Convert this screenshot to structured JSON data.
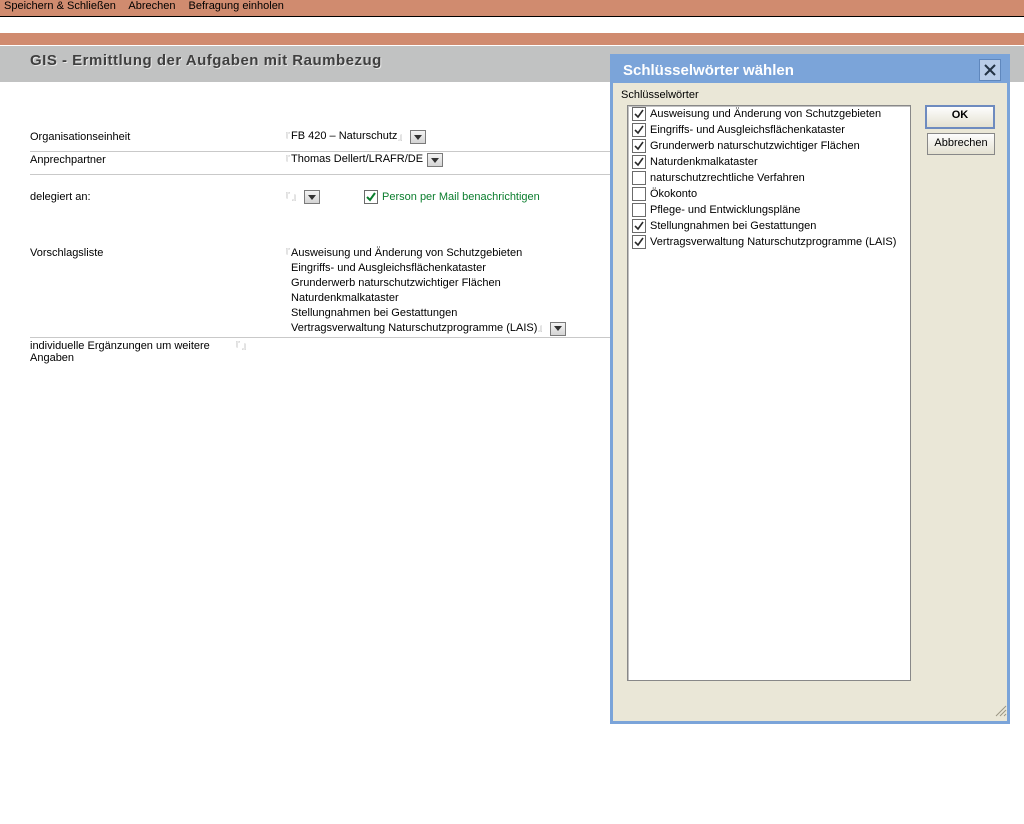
{
  "toolbar": {
    "save_close": "Speichern & Schließen",
    "cancel": "Abrechen",
    "request": "Befragung einholen"
  },
  "title": "GIS - Ermittlung der Aufgaben mit Raumbezug",
  "form": {
    "org_label": "Organisationseinheit",
    "org_value": "FB 420 – Naturschutz",
    "contact_label": "Anprechpartner",
    "contact_value": "Thomas Dellert/LRAFR/DE",
    "delegated_label": "delegiert an:",
    "delegated_value": "",
    "notify_label": "Person per Mail benachrichtigen",
    "suggestion_label": "Vorschlagsliste",
    "suggestion_lines": [
      "Ausweisung und Änderung von Schutzgebieten",
      "Eingriffs- und Ausgleichsflächenkataster",
      "Grunderwerb naturschutzwichtiger Flächen",
      "Naturdenkmalkataster",
      "Stellungnahmen bei Gestattungen",
      "Vertragsverwaltung Naturschutzprogramme (LAIS)"
    ],
    "additional_label": "individuelle Ergänzungen um weitere Angaben"
  },
  "dialog": {
    "title": "Schlüsselwörter wählen",
    "list_label": "Schlüsselwörter",
    "ok": "OK",
    "cancel": "Abbrechen",
    "items": [
      {
        "checked": true,
        "text": "Ausweisung und Änderung von Schutzgebieten"
      },
      {
        "checked": true,
        "text": "Eingriffs- und Ausgleichsflächenkataster"
      },
      {
        "checked": true,
        "text": "Grunderwerb naturschutzwichtiger Flächen"
      },
      {
        "checked": true,
        "text": "Naturdenkmalkataster"
      },
      {
        "checked": false,
        "text": "naturschutzrechtliche Verfahren"
      },
      {
        "checked": false,
        "text": "Ökokonto"
      },
      {
        "checked": false,
        "text": "Pflege- und Entwicklungspläne"
      },
      {
        "checked": true,
        "text": "Stellungnahmen bei Gestattungen"
      },
      {
        "checked": true,
        "text": "Vertragsverwaltung Naturschutzprogramme (LAIS)"
      }
    ]
  }
}
